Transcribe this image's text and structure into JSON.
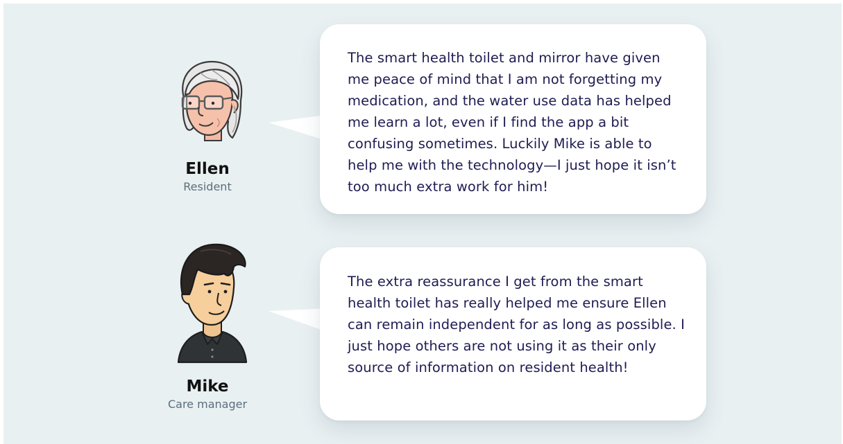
{
  "background_color": "#e9f0f2",
  "bubble_color": "#ffffff",
  "quote_text_color": "#1e1c52",
  "role_text_color": "#5a6f7c",
  "testimonials": [
    {
      "avatar_icon": "elderly-woman-glasses-avatar-icon",
      "name": "Ellen",
      "role": "Resident",
      "quote": "The smart health toilet and mirror have given me peace of mind that I am not forgetting my medication, and the water use data has helped me learn a lot, even if I find the app a bit confusing sometimes. Luckily Mike is able to help me with the technology—I just hope it isn’t too much extra work for him!"
    },
    {
      "avatar_icon": "young-man-avatar-icon",
      "name": "Mike",
      "role": "Care manager",
      "quote": "The extra reassurance I get from the smart health toilet has really helped me ensure Ellen can remain independent for as long as possible. I just hope others are not using it as their only source of information on resident health!"
    }
  ]
}
